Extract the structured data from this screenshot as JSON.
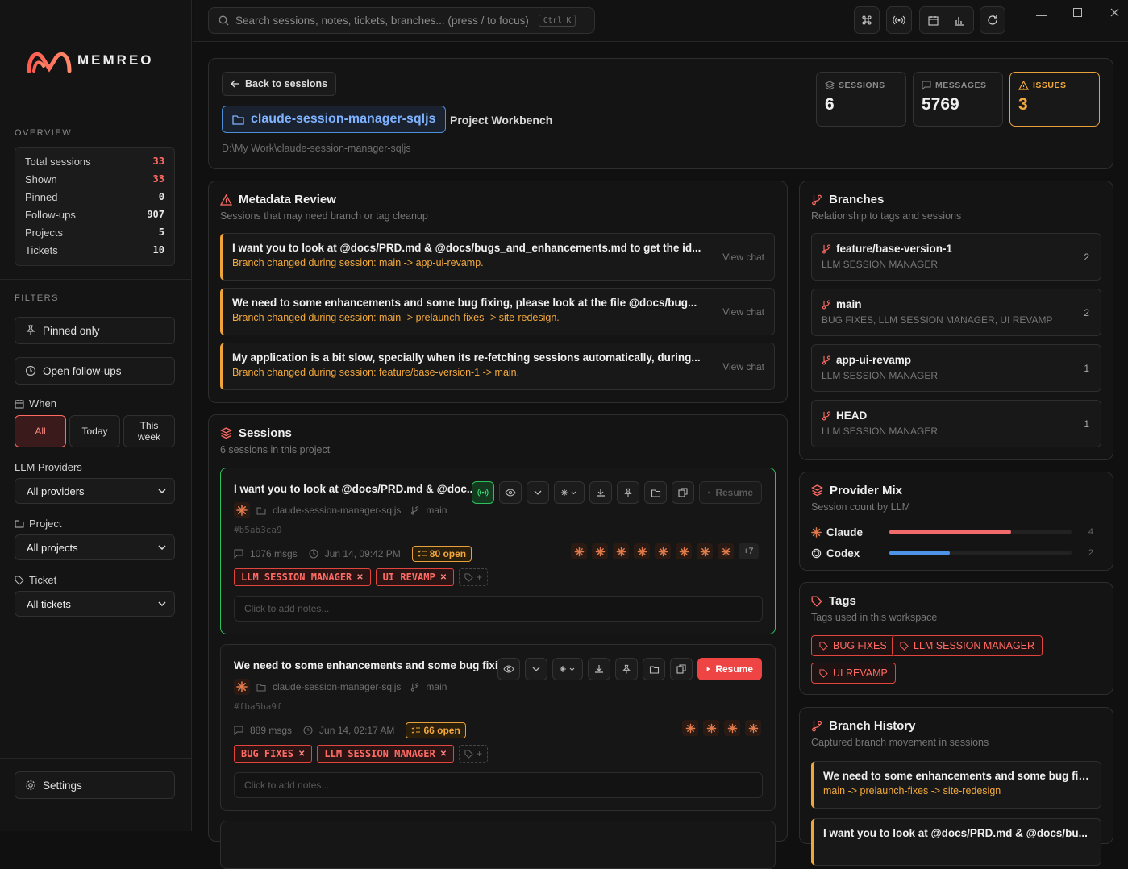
{
  "app": {
    "brand": "MEMREO"
  },
  "sidebar": {
    "overview_label": "OVERVIEW",
    "stats": [
      {
        "label": "Total sessions",
        "value": "33",
        "accent": true
      },
      {
        "label": "Shown",
        "value": "33",
        "accent": true
      },
      {
        "label": "Pinned",
        "value": "0",
        "accent": false
      },
      {
        "label": "Follow-ups",
        "value": "907",
        "accent": false
      },
      {
        "label": "Projects",
        "value": "5",
        "accent": false
      },
      {
        "label": "Tickets",
        "value": "10",
        "accent": false
      }
    ],
    "filters_label": "FILTERS",
    "pinned_only": "Pinned only",
    "open_followups": "Open follow-ups",
    "when_label": "When",
    "when_options": [
      "All",
      "Today",
      "This week"
    ],
    "when_selected": "All",
    "providers_label": "LLM Providers",
    "providers_value": "All providers",
    "project_label": "Project",
    "project_value": "All projects",
    "ticket_label": "Ticket",
    "ticket_value": "All tickets",
    "settings": "Settings"
  },
  "topbar": {
    "search_placeholder": "Search sessions, notes, tickets, branches... (press / to focus)",
    "search_kbd": "Ctrl K"
  },
  "header": {
    "back": "Back to sessions",
    "project_name": "claude-session-manager-sqljs",
    "workbench": "Project Workbench",
    "path": "D:\\My Work\\claude-session-manager-sqljs",
    "cards": [
      {
        "label": "SESSIONS",
        "value": "6"
      },
      {
        "label": "MESSAGES",
        "value": "5769"
      },
      {
        "label": "ISSUES",
        "value": "3"
      }
    ]
  },
  "metadata_review": {
    "title": "Metadata Review",
    "subtitle": "Sessions that may need branch or tag cleanup",
    "items": [
      {
        "title": "I want you to look at @docs/PRD.md & @docs/bugs_and_enhancements.md to get the id...",
        "sub": "Branch changed during session: main -> app-ui-revamp.",
        "link": "View chat"
      },
      {
        "title": "We need to some enhancements and some bug fixing, please look at the file @docs/bug...",
        "sub": "Branch changed during session: main -> prelaunch-fixes -> site-redesign.",
        "link": "View chat"
      },
      {
        "title": "My application is a bit slow, specially when its re-fetching sessions automatically, during...",
        "sub": "Branch changed during session: feature/base-version-1 -> main.",
        "link": "View chat"
      }
    ]
  },
  "branches": {
    "title": "Branches",
    "subtitle": "Relationship to tags and sessions",
    "items": [
      {
        "name": "feature/base-version-1",
        "tags": "LLM SESSION MANAGER",
        "count": "2"
      },
      {
        "name": "main",
        "tags": "BUG FIXES, LLM SESSION MANAGER, UI REVAMP",
        "count": "2"
      },
      {
        "name": "app-ui-revamp",
        "tags": "LLM SESSION MANAGER",
        "count": "1"
      },
      {
        "name": "HEAD",
        "tags": "LLM SESSION MANAGER",
        "count": "1"
      }
    ]
  },
  "sessions": {
    "title": "Sessions",
    "subtitle": "6 sessions in this project",
    "items": [
      {
        "title": "I want you to look at @docs/PRD.md & @doc...",
        "project": "claude-session-manager-sqljs",
        "branch": "main",
        "hash": "#b5ab3ca9",
        "msgs": "1076 msgs",
        "date": "Jun 14, 09:42 PM",
        "open": "80 open",
        "tags": [
          "LLM SESSION MANAGER",
          "UI REVAMP"
        ],
        "notes_placeholder": "Click to add notes...",
        "resume": "Resume",
        "more": "+7"
      },
      {
        "title": "We need to some enhancements and some bug fixi...",
        "project": "claude-session-manager-sqljs",
        "branch": "main",
        "hash": "#fba5ba9f",
        "msgs": "889 msgs",
        "date": "Jun 14, 02:17 AM",
        "open": "66 open",
        "tags": [
          "BUG FIXES",
          "LLM SESSION MANAGER"
        ],
        "notes_placeholder": "Click to add notes...",
        "resume": "Resume"
      }
    ]
  },
  "provider_mix": {
    "title": "Provider Mix",
    "subtitle": "Session count by LLM",
    "items": [
      {
        "name": "Claude",
        "count": "4",
        "fraction": 0.67,
        "color": "#f26b6b"
      },
      {
        "name": "Codex",
        "count": "2",
        "fraction": 0.33,
        "color": "#4d94e8"
      }
    ]
  },
  "tags_panel": {
    "title": "Tags",
    "subtitle": "Tags used in this workspace",
    "items": [
      "BUG FIXES",
      "LLM SESSION MANAGER",
      "UI REVAMP"
    ]
  },
  "branch_history": {
    "title": "Branch History",
    "subtitle": "Captured branch movement in sessions",
    "items": [
      {
        "title": "We need to some enhancements and some bug fix...",
        "path": "main -> prelaunch-fixes -> site-redesign"
      },
      {
        "title": "I want you to look at @docs/PRD.md & @docs/bu...",
        "path": ""
      }
    ]
  },
  "colors": {
    "accent": "#ff6b63",
    "warning": "#f3a93d",
    "live": "#2fbf5d",
    "link": "#7fb3ff"
  }
}
